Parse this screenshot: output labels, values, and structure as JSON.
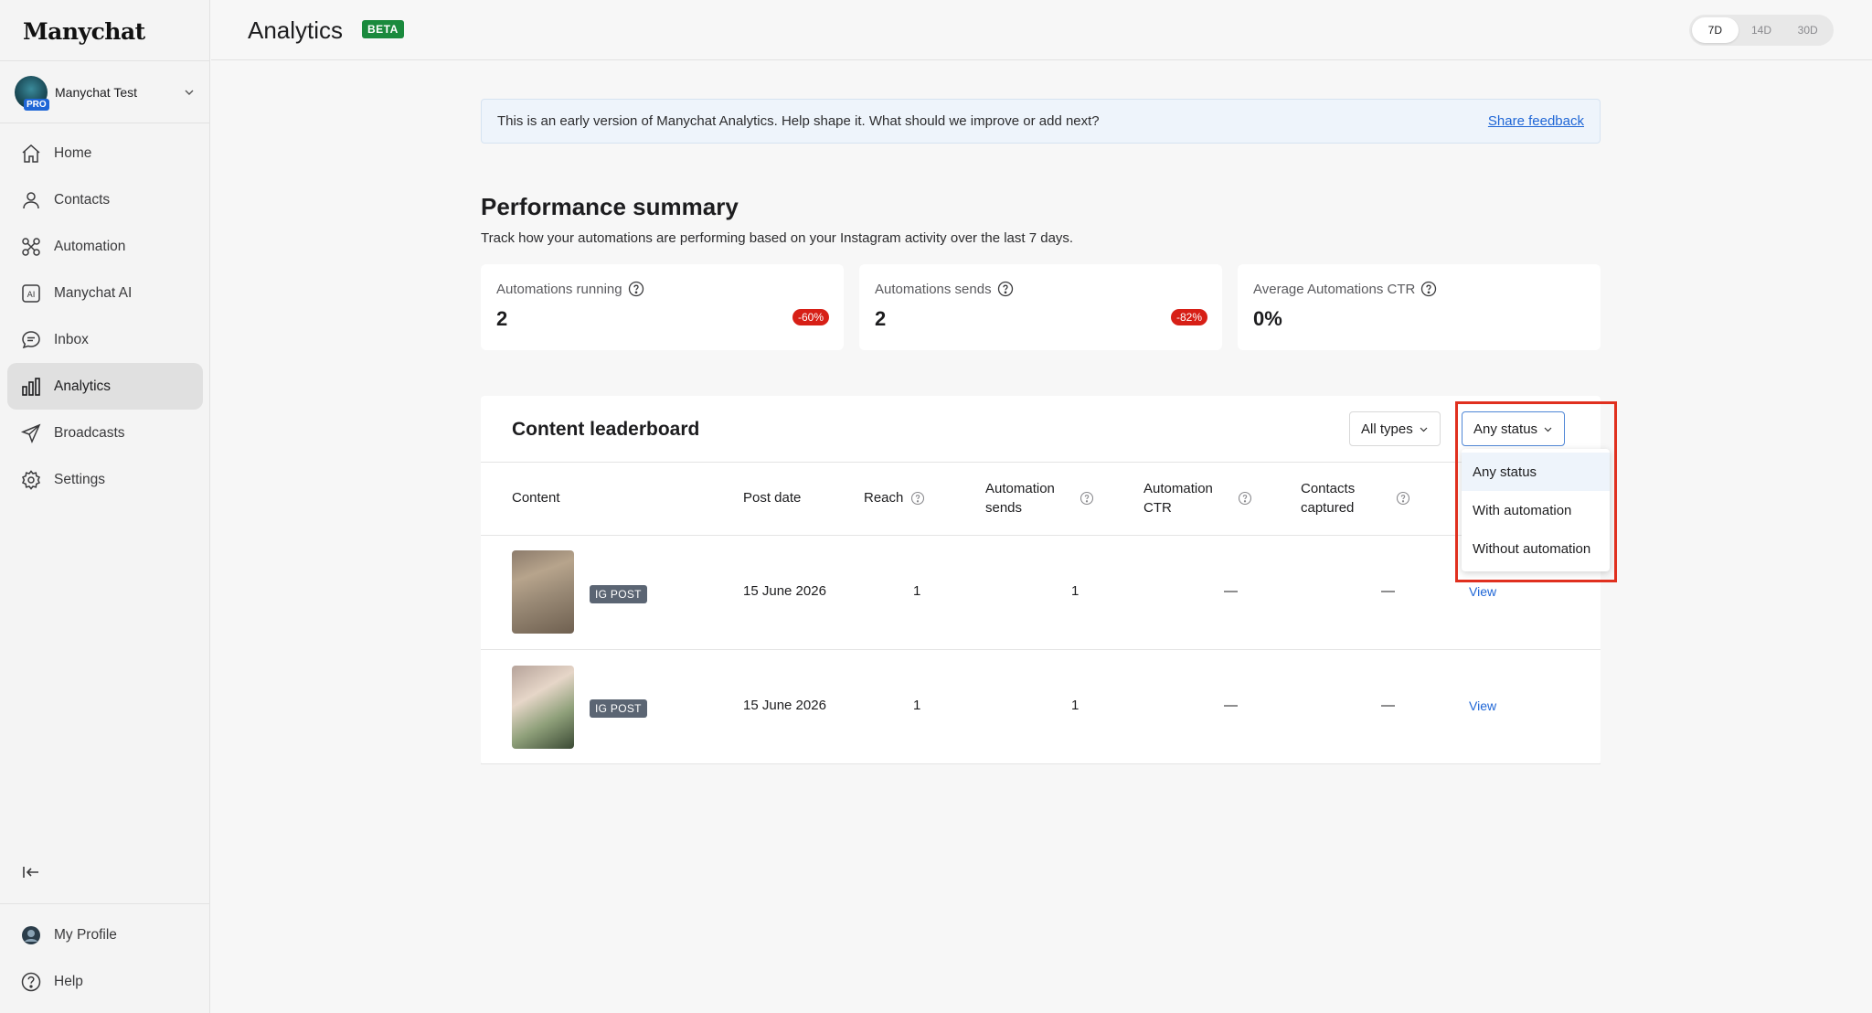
{
  "app": {
    "logo": "Manychat"
  },
  "account": {
    "name": "Manychat Test",
    "badge": "PRO"
  },
  "nav": {
    "items": [
      {
        "label": "Home",
        "icon": "home-icon"
      },
      {
        "label": "Contacts",
        "icon": "contacts-icon"
      },
      {
        "label": "Automation",
        "icon": "automation-icon"
      },
      {
        "label": "Manychat AI",
        "icon": "ai-icon"
      },
      {
        "label": "Inbox",
        "icon": "inbox-icon"
      },
      {
        "label": "Analytics",
        "icon": "analytics-icon",
        "active": true
      },
      {
        "label": "Broadcasts",
        "icon": "broadcasts-icon"
      },
      {
        "label": "Settings",
        "icon": "settings-icon"
      }
    ],
    "bottom": [
      {
        "label": "My Profile",
        "icon": "profile-avatar-icon"
      },
      {
        "label": "Help",
        "icon": "help-icon"
      }
    ]
  },
  "header": {
    "title": "Analytics",
    "badge": "BETA",
    "ranges": [
      "7D",
      "14D",
      "30D"
    ],
    "active_range": "7D"
  },
  "banner": {
    "text": "This is an early version of Manychat Analytics. Help shape it. What should we improve or add next?",
    "link": "Share feedback"
  },
  "summary": {
    "title": "Performance summary",
    "subtitle": "Track how your automations are performing based on your Instagram activity over the last 7 days.",
    "cards": [
      {
        "label": "Automations running",
        "value": "2",
        "delta": "-60%"
      },
      {
        "label": "Automations sends",
        "value": "2",
        "delta": "-82%"
      },
      {
        "label": "Average Automations CTR",
        "value": "0%",
        "delta": ""
      }
    ]
  },
  "leaderboard": {
    "title": "Content leaderboard",
    "type_filter": "All types",
    "status_filter": "Any status",
    "columns": {
      "content": "Content",
      "post_date": "Post date",
      "reach": "Reach",
      "automation_sends_1": "Automation",
      "automation_sends_2": "sends",
      "automation_ctr_1": "Automation",
      "automation_ctr_2": "CTR",
      "contacts_captured_1": "Contacts",
      "contacts_captured_2": "captured"
    },
    "rows": [
      {
        "tag": "IG POST",
        "post_date": "15 June 2026",
        "reach": "1",
        "automation_sends": "1",
        "automation_ctr": "—",
        "contacts_captured": "—",
        "action": "View"
      },
      {
        "tag": "IG POST",
        "post_date": "15 June 2026",
        "reach": "1",
        "automation_sends": "1",
        "automation_ctr": "—",
        "contacts_captured": "—",
        "action": "View"
      }
    ]
  },
  "status_menu": {
    "options": [
      "Any status",
      "With automation",
      "Without automation"
    ],
    "selected": "Any status"
  },
  "colors": {
    "accent": "#1f66d6",
    "beta": "#1a8a3d",
    "negative": "#d71f16",
    "highlight": "#e0301f"
  }
}
